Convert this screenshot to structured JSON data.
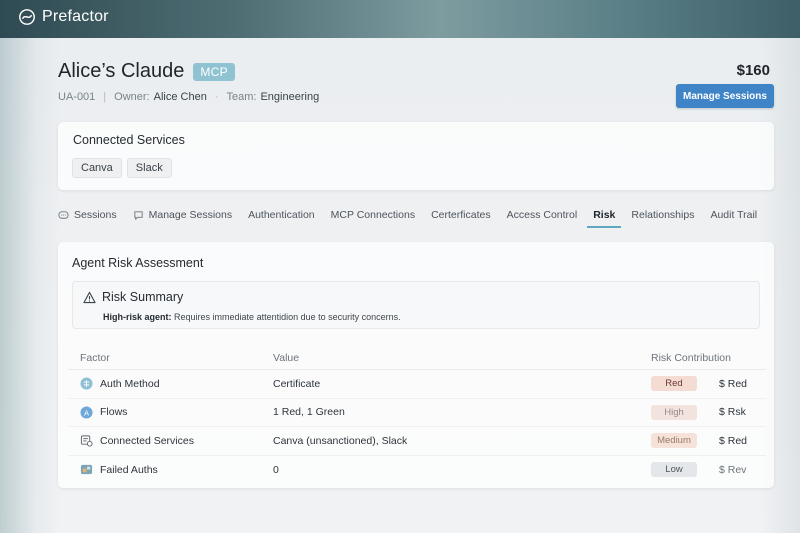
{
  "app": {
    "brand": "Prefactor"
  },
  "agent": {
    "title": "Alice’s Claude",
    "badge": "MCP",
    "id": "UA-001",
    "owner_label": "Owner:",
    "owner": "Alice Chen",
    "team_label": "Team:",
    "team": "Engineering",
    "price": "$160",
    "primary_button": "Manage Sessions"
  },
  "services": {
    "title": "Connected Services",
    "chips": [
      "Canva",
      "Slack"
    ]
  },
  "tabs": [
    {
      "label": "Sessions",
      "icon": "chat-icon",
      "active": false
    },
    {
      "label": "Manage Sessions",
      "icon": "chat-bubble-icon",
      "active": false
    },
    {
      "label": "Authentication",
      "active": false
    },
    {
      "label": "MCP Connections",
      "active": false
    },
    {
      "label": "Certerficates",
      "active": false
    },
    {
      "label": "Access Control",
      "active": false
    },
    {
      "label": "Risk",
      "active": true
    },
    {
      "label": "Relationships",
      "active": false
    },
    {
      "label": "Audit Trail",
      "active": false
    }
  ],
  "risk": {
    "title": "Agent Risk Assessment",
    "summary_title": "Risk Summary",
    "summary_label": "High-risk agent:",
    "summary_text": "Requires immediate attentidion due to security concerns.",
    "columns": [
      "Factor",
      "Value",
      "Risk Contribution"
    ],
    "rows": [
      {
        "factor": "Auth Method",
        "icon": "auth-method-icon",
        "value": "Certificate",
        "level": "Red",
        "contribution": "$ Red"
      },
      {
        "factor": "Flows",
        "icon": "flows-icon",
        "value": "1 Red, 1 Green",
        "level": "High",
        "contribution": "$ Rsk"
      },
      {
        "factor": "Connected Services",
        "icon": "services-icon",
        "value": "Canva (unsanctioned), Slack",
        "level": "Medium",
        "contribution": "$ Red"
      },
      {
        "factor": "Failed Auths",
        "icon": "failed-auths-icon",
        "value": "0",
        "level": "Low",
        "contribution": "$ Rev"
      }
    ]
  },
  "colors": {
    "accent": "#3f84c7",
    "badge": "#8fc3d2",
    "tab_underline": "#5fa6c0"
  }
}
